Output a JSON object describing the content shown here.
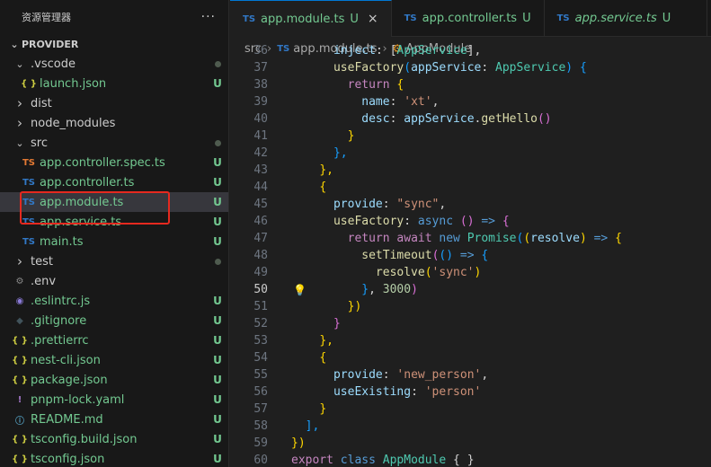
{
  "sidebar": {
    "title": "资源管理器",
    "more": "···",
    "section": "PROVIDER",
    "items": [
      {
        "label": ".vscode",
        "type": "folder",
        "open": true,
        "depth": 1,
        "status": "dot"
      },
      {
        "label": "launch.json",
        "type": "json",
        "icon": "{ }",
        "depth": 2,
        "status": "U"
      },
      {
        "label": "dist",
        "type": "folder",
        "open": false,
        "depth": 1,
        "status": ""
      },
      {
        "label": "node_modules",
        "type": "folder",
        "open": false,
        "depth": 1,
        "status": ""
      },
      {
        "label": "src",
        "type": "folder",
        "open": true,
        "depth": 1,
        "status": "dot"
      },
      {
        "label": "app.controller.spec.ts",
        "type": "tsr",
        "icon": "TS",
        "depth": 2,
        "status": "U"
      },
      {
        "label": "app.controller.ts",
        "type": "ts",
        "icon": "TS",
        "depth": 2,
        "status": "U"
      },
      {
        "label": "app.module.ts",
        "type": "ts",
        "icon": "TS",
        "depth": 2,
        "status": "U",
        "selected": true
      },
      {
        "label": "app.service.ts",
        "type": "ts",
        "icon": "TS",
        "depth": 2,
        "status": "U"
      },
      {
        "label": "main.ts",
        "type": "ts",
        "icon": "TS",
        "depth": 2,
        "status": "U"
      },
      {
        "label": "test",
        "type": "folder",
        "open": false,
        "depth": 1,
        "status": "dot"
      },
      {
        "label": ".env",
        "type": "env",
        "icon": "⚙",
        "depth": 1,
        "status": ""
      },
      {
        "label": ".eslintrc.js",
        "type": "eslint",
        "icon": "◉",
        "depth": 1,
        "status": "U"
      },
      {
        "label": ".gitignore",
        "type": "git",
        "icon": "◆",
        "depth": 1,
        "status": "U"
      },
      {
        "label": ".prettierrc",
        "type": "json",
        "icon": "{ }",
        "depth": 1,
        "status": "U"
      },
      {
        "label": "nest-cli.json",
        "type": "json",
        "icon": "{ }",
        "depth": 1,
        "status": "U"
      },
      {
        "label": "package.json",
        "type": "json",
        "icon": "{ }",
        "depth": 1,
        "status": "U"
      },
      {
        "label": "pnpm-lock.yaml",
        "type": "yaml",
        "icon": "!",
        "depth": 1,
        "status": "U"
      },
      {
        "label": "README.md",
        "type": "md",
        "icon": "ⓘ",
        "depth": 1,
        "status": "U"
      },
      {
        "label": "tsconfig.build.json",
        "type": "json",
        "icon": "{ }",
        "depth": 1,
        "status": "U"
      },
      {
        "label": "tsconfig.json",
        "type": "json",
        "icon": "{ }",
        "depth": 1,
        "status": "U"
      }
    ]
  },
  "tabs": [
    {
      "icon": "TS",
      "label": "app.module.ts",
      "status": "U",
      "active": true,
      "close": "×"
    },
    {
      "icon": "TS",
      "label": "app.controller.ts",
      "status": "U",
      "active": false
    },
    {
      "icon": "TS",
      "label": "app.service.ts",
      "status": "U",
      "active": false,
      "italic": true
    }
  ],
  "breadcrumb": {
    "folder": "src",
    "file_icon": "TS",
    "file": "app.module.ts",
    "symbol": "AppModule"
  },
  "code": {
    "current_line": 50,
    "lines": [
      {
        "n": "36",
        "t": [
          [
            "      ",
            "pu"
          ],
          [
            "inject",
            "pr"
          ],
          [
            ": [",
            "pu"
          ],
          [
            "AppService",
            "ty"
          ],
          [
            "],",
            "pu"
          ]
        ]
      },
      {
        "n": "37",
        "t": [
          [
            "      ",
            "pu"
          ],
          [
            "useFactory",
            "fn"
          ],
          [
            "(",
            "b3"
          ],
          [
            "appService",
            "pr"
          ],
          [
            ": ",
            "pu"
          ],
          [
            "AppService",
            "ty"
          ],
          [
            ") ",
            "b3"
          ],
          [
            "{",
            "b3"
          ]
        ]
      },
      {
        "n": "38",
        "t": [
          [
            "        ",
            "pu"
          ],
          [
            "return",
            "kw2"
          ],
          [
            " ",
            "pu"
          ],
          [
            "{",
            "b1"
          ]
        ]
      },
      {
        "n": "39",
        "t": [
          [
            "          ",
            "pu"
          ],
          [
            "name",
            "pr"
          ],
          [
            ": ",
            "pu"
          ],
          [
            "'xt'",
            "str"
          ],
          [
            ",",
            "pu"
          ]
        ]
      },
      {
        "n": "40",
        "t": [
          [
            "          ",
            "pu"
          ],
          [
            "desc",
            "pr"
          ],
          [
            ": ",
            "pu"
          ],
          [
            "appService",
            "pr"
          ],
          [
            ".",
            "pu"
          ],
          [
            "getHello",
            "fn"
          ],
          [
            "()",
            "b2"
          ]
        ]
      },
      {
        "n": "41",
        "t": [
          [
            "        ",
            "pu"
          ],
          [
            "}",
            "b1"
          ]
        ]
      },
      {
        "n": "42",
        "t": [
          [
            "      ",
            "pu"
          ],
          [
            "},",
            "b3"
          ]
        ]
      },
      {
        "n": "43",
        "t": [
          [
            "    ",
            "pu"
          ],
          [
            "},",
            "b1"
          ]
        ]
      },
      {
        "n": "44",
        "t": [
          [
            "    ",
            "pu"
          ],
          [
            "{",
            "b1"
          ]
        ]
      },
      {
        "n": "45",
        "t": [
          [
            "      ",
            "pu"
          ],
          [
            "provide",
            "pr"
          ],
          [
            ": ",
            "pu"
          ],
          [
            "\"sync\"",
            "str"
          ],
          [
            ",",
            "pu"
          ]
        ]
      },
      {
        "n": "46",
        "t": [
          [
            "      ",
            "pu"
          ],
          [
            "useFactory",
            "fn"
          ],
          [
            ": ",
            "pu"
          ],
          [
            "async",
            "kw"
          ],
          [
            " ",
            "pu"
          ],
          [
            "()",
            "b2"
          ],
          [
            " ",
            "pu"
          ],
          [
            "=>",
            "kw"
          ],
          [
            " ",
            "pu"
          ],
          [
            "{",
            "b2"
          ]
        ]
      },
      {
        "n": "47",
        "t": [
          [
            "        ",
            "pu"
          ],
          [
            "return",
            "kw2"
          ],
          [
            " ",
            "pu"
          ],
          [
            "await",
            "kw2"
          ],
          [
            " ",
            "pu"
          ],
          [
            "new",
            "kw"
          ],
          [
            " ",
            "pu"
          ],
          [
            "Promise",
            "ty"
          ],
          [
            "(",
            "b3"
          ],
          [
            "(",
            "b1"
          ],
          [
            "resolve",
            "pr"
          ],
          [
            ")",
            "b1"
          ],
          [
            " ",
            "pu"
          ],
          [
            "=>",
            "kw"
          ],
          [
            " ",
            "pu"
          ],
          [
            "{",
            "b1"
          ]
        ]
      },
      {
        "n": "48",
        "t": [
          [
            "          ",
            "pu"
          ],
          [
            "setTimeout",
            "fn"
          ],
          [
            "(",
            "b2"
          ],
          [
            "()",
            "b3"
          ],
          [
            " ",
            "pu"
          ],
          [
            "=>",
            "kw"
          ],
          [
            " ",
            "pu"
          ],
          [
            "{",
            "b3"
          ]
        ]
      },
      {
        "n": "49",
        "t": [
          [
            "            ",
            "pu"
          ],
          [
            "resolve",
            "fn"
          ],
          [
            "(",
            "b1"
          ],
          [
            "'sync'",
            "str"
          ],
          [
            ")",
            "b1"
          ]
        ]
      },
      {
        "n": "50",
        "t": [
          [
            "          ",
            "pu"
          ],
          [
            "}",
            "b3"
          ],
          [
            ", ",
            "pu"
          ],
          [
            "3000",
            "num"
          ],
          [
            ")",
            "b2"
          ]
        ]
      },
      {
        "n": "51",
        "t": [
          [
            "        ",
            "pu"
          ],
          [
            "})",
            "b1"
          ]
        ]
      },
      {
        "n": "52",
        "t": [
          [
            "      ",
            "pu"
          ],
          [
            "}",
            "b2"
          ]
        ]
      },
      {
        "n": "53",
        "t": [
          [
            "    ",
            "pu"
          ],
          [
            "},",
            "b1"
          ]
        ]
      },
      {
        "n": "54",
        "t": [
          [
            "    ",
            "pu"
          ],
          [
            "{",
            "b1"
          ]
        ]
      },
      {
        "n": "55",
        "t": [
          [
            "      ",
            "pu"
          ],
          [
            "provide",
            "pr"
          ],
          [
            ": ",
            "pu"
          ],
          [
            "'new_person'",
            "str"
          ],
          [
            ",",
            "pu"
          ]
        ]
      },
      {
        "n": "56",
        "t": [
          [
            "      ",
            "pu"
          ],
          [
            "useExisting",
            "pr"
          ],
          [
            ": ",
            "pu"
          ],
          [
            "'person'",
            "str"
          ]
        ]
      },
      {
        "n": "57",
        "t": [
          [
            "    ",
            "pu"
          ],
          [
            "}",
            "b1"
          ]
        ]
      },
      {
        "n": "58",
        "t": [
          [
            "  ",
            "pu"
          ],
          [
            "],",
            "b3"
          ]
        ]
      },
      {
        "n": "59",
        "t": [
          [
            "",
            "pu"
          ],
          [
            "})",
            "b1"
          ]
        ]
      },
      {
        "n": "60",
        "t": [
          [
            "",
            "pu"
          ],
          [
            "export",
            "kw2"
          ],
          [
            " ",
            "pu"
          ],
          [
            "class",
            "kw"
          ],
          [
            " ",
            "pu"
          ],
          [
            "AppModule",
            "ty"
          ],
          [
            " ",
            "pu"
          ],
          [
            "{ }",
            "pu"
          ]
        ]
      }
    ]
  },
  "colors": {
    "highlight": "#e5291f",
    "accent": "#0078d4",
    "untracked": "#73c991"
  }
}
